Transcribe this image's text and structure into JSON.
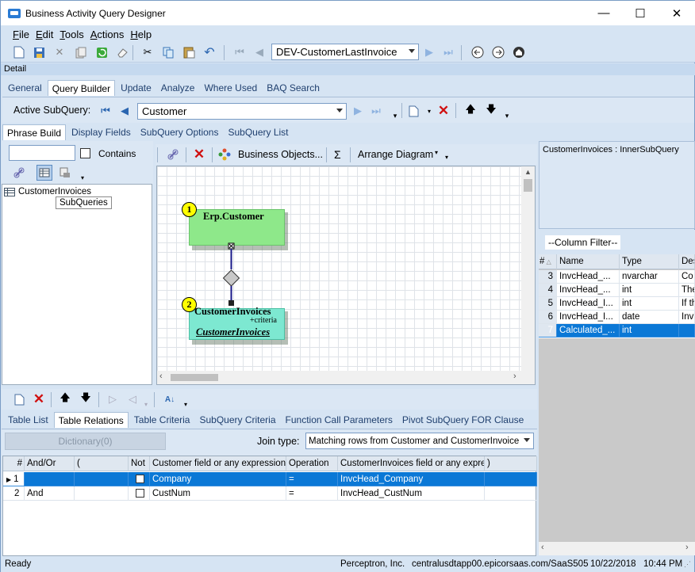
{
  "window": {
    "title": "Business Activity Query Designer",
    "minimize": "—",
    "maximize": "☐",
    "close": "✕"
  },
  "menu": {
    "items": [
      "File",
      "Edit",
      "Tools",
      "Actions",
      "Help"
    ],
    "underline": [
      "F",
      "E",
      "T",
      "A",
      "H"
    ]
  },
  "toolbar": {
    "query_combo": "DEV-CustomerLastInvoice"
  },
  "detail_label": "Detail",
  "main_tabs": [
    "General",
    "Query Builder",
    "Update",
    "Analyze",
    "Where Used",
    "BAQ Search"
  ],
  "subquery": {
    "label": "Active SubQuery:",
    "value": "Customer"
  },
  "sub_tabs": [
    "Phrase Build",
    "Display Fields",
    "SubQuery Options",
    "SubQuery List"
  ],
  "left_panel": {
    "search_value": "",
    "contains_label": "Contains",
    "tree_item": "CustomerInvoices",
    "tooltip": "SubQueries"
  },
  "diagram_toolbar": {
    "business_objects": "Business Objects...",
    "sigma": "Σ",
    "arrange": "Arrange Diagram"
  },
  "diagram": {
    "table1": {
      "num": "1",
      "name": "Erp.Customer",
      "color": "#8ee88a"
    },
    "table2": {
      "num": "2",
      "name": "CustomerInvoices",
      "criteria": "+criteria",
      "link": "CustomerInvoices",
      "color": "#7de8d1"
    }
  },
  "right_panel": {
    "subquery_title": "CustomerInvoices : InnerSubQuery",
    "filter_tab": "--Column Filter--",
    "headers": [
      "#",
      "Name",
      "Type",
      "Des"
    ],
    "rows": [
      {
        "n": "3",
        "name": "InvcHead_...",
        "type": "nvarchar",
        "desc": "Co"
      },
      {
        "n": "4",
        "name": "InvcHead_...",
        "type": "int",
        "desc": "The"
      },
      {
        "n": "5",
        "name": "InvcHead_I...",
        "type": "int",
        "desc": "If th"
      },
      {
        "n": "6",
        "name": "InvcHead_I...",
        "type": "date",
        "desc": "Inv"
      },
      {
        "n": "7",
        "name": "Calculated_...",
        "type": "int",
        "desc": ""
      }
    ]
  },
  "bottom_tabs": [
    "Table List",
    "Table Relations",
    "Table Criteria",
    "SubQuery Criteria",
    "Function Call Parameters",
    "Pivot SubQuery FOR Clause"
  ],
  "relations": {
    "dictionary_btn": "Dictionary(0)",
    "join_label": "Join type:",
    "join_value": "Matching rows from Customer and CustomerInvoice",
    "headers": [
      "#",
      "And/Or",
      "(",
      "Not",
      "Customer field or any expression",
      "Operation",
      "CustomerInvoices field or any expre",
      ")"
    ],
    "rows": [
      {
        "n": "1",
        "andor": "",
        "paren": "",
        "field": "Company",
        "op": "=",
        "field2": "InvcHead_Company"
      },
      {
        "n": "2",
        "andor": "And",
        "paren": "",
        "field": "CustNum",
        "op": "=",
        "field2": "InvcHead_CustNum"
      }
    ]
  },
  "status": {
    "left": "Ready",
    "company": "Perceptron, Inc.",
    "server": "centralusdtapp00.epicorsaas.com/SaaS505",
    "date": "10/22/2018",
    "time": "10:44 PM"
  }
}
